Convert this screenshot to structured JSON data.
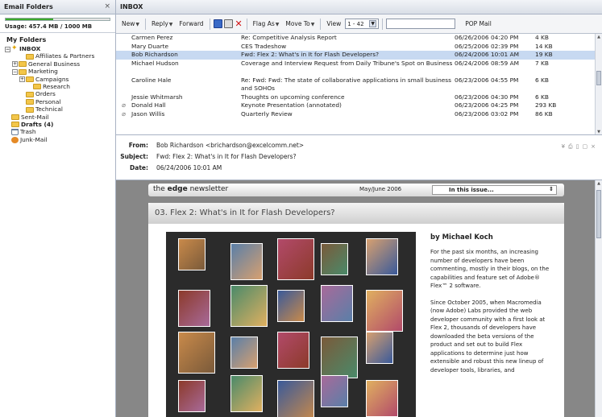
{
  "folders_panel": {
    "title": "Email Folders",
    "close": "×",
    "usage": {
      "text": "Usage: 457.4 MB / 1000 MB",
      "fraction": 0.4574
    },
    "root": "My Folders",
    "tree": [
      {
        "label": "INBOX",
        "indent": 0,
        "toggle": "−",
        "icon": "inbox-icon",
        "bold": true
      },
      {
        "label": "Affiliates & Partners",
        "indent": 2,
        "toggle": "",
        "icon": "folder-icon",
        "bold": false
      },
      {
        "label": "General Business",
        "indent": 1,
        "toggle": "+",
        "icon": "folder-icon",
        "bold": false
      },
      {
        "label": "Marketing",
        "indent": 1,
        "toggle": "−",
        "icon": "folder-icon",
        "bold": false
      },
      {
        "label": "Campaigns",
        "indent": 2,
        "toggle": "+",
        "icon": "folder-icon",
        "bold": false
      },
      {
        "label": "Research",
        "indent": 3,
        "toggle": "",
        "icon": "folder-icon",
        "bold": false
      },
      {
        "label": "Orders",
        "indent": 2,
        "toggle": "",
        "icon": "folder-icon",
        "bold": false
      },
      {
        "label": "Personal",
        "indent": 2,
        "toggle": "",
        "icon": "folder-icon",
        "bold": false
      },
      {
        "label": "Technical",
        "indent": 2,
        "toggle": "",
        "icon": "folder-icon",
        "bold": false
      },
      {
        "label": "Sent-Mail",
        "indent": 0,
        "toggle": "",
        "icon": "folder-icon",
        "bold": false
      },
      {
        "label": "Drafts (4)",
        "indent": 0,
        "toggle": "",
        "icon": "folder-icon",
        "bold": true
      },
      {
        "label": "Trash",
        "indent": 0,
        "toggle": "",
        "icon": "trash-icon",
        "bold": false
      },
      {
        "label": "Junk-Mail",
        "indent": 0,
        "toggle": "",
        "icon": "junk-icon",
        "bold": false
      }
    ]
  },
  "main": {
    "title": "INBOX",
    "toolbar": {
      "new": "New",
      "reply": "Reply",
      "forward": "Forward",
      "flag_as": "Flag As",
      "move_to": "Move To",
      "view": "View",
      "range": "1 - 42",
      "search_placeholder": "",
      "pop_mail": "POP Mail"
    },
    "messages": [
      {
        "from": "Carmen Perez",
        "subject": "Re: Competitive Analysis Report",
        "date": "06/26/2006 04:20 PM",
        "size": "4 KB",
        "attachment": false,
        "selected": false,
        "tall": false
      },
      {
        "from": "Mary Duarte",
        "subject": "CES Tradeshow",
        "date": "06/25/2006 02:39 PM",
        "size": "14 KB",
        "attachment": false,
        "selected": false,
        "tall": false
      },
      {
        "from": "Bob Richardson",
        "subject": "Fwd: Flex 2: What's in It for Flash Developers?",
        "date": "06/24/2006 10:01 AM",
        "size": "19 KB",
        "attachment": false,
        "selected": true,
        "tall": false
      },
      {
        "from": "Michael Hudson",
        "subject": "Coverage and Interview Request from Daily Tribune's Spot on Business",
        "date": "06/24/2006 08:59 AM",
        "size": "7 KB",
        "attachment": false,
        "selected": false,
        "tall": true
      },
      {
        "from": "Caroline Hale",
        "subject": "Re: Fwd: Fwd: The state of collaborative applications in small business and SOHOs",
        "date": "06/23/2006 04:55 PM",
        "size": "6 KB",
        "attachment": false,
        "selected": false,
        "tall": true
      },
      {
        "from": "Jessie Whitmarsh",
        "subject": "Thoughts on upcoming conference",
        "date": "06/23/2006 04:30 PM",
        "size": "6 KB",
        "attachment": false,
        "selected": false,
        "tall": false
      },
      {
        "from": "Donald Hall",
        "subject": "Keynote Presentation (annotated)",
        "date": "06/23/2006 04:25 PM",
        "size": "293 KB",
        "attachment": true,
        "selected": false,
        "tall": false
      },
      {
        "from": "Jason Willis",
        "subject": "Quarterly Review",
        "date": "06/23/2006 03:02 PM",
        "size": "86 KB",
        "attachment": true,
        "selected": false,
        "tall": false
      }
    ],
    "header": {
      "from_label": "From:",
      "from": "Bob Richardson <brichardson@excelcomm.net>",
      "subject_label": "Subject:",
      "subject": "Fwd: Flex 2: What's in It for Flash Developers?",
      "date_label": "Date:",
      "date": "06/24/2006 10:01 AM"
    },
    "newsletter": {
      "brand_pre": "the ",
      "brand_bold": "edge",
      "brand_post": " newsletter",
      "issue_date": "May/June 2006",
      "select_label": "In this issue...",
      "article_title": "03. Flex 2: What's in It for Flash Developers?",
      "author": "by Michael Koch",
      "paragraphs": [
        "For the past six months, an increasing number of developers have been commenting, mostly in their blogs, on the capabilities and feature set of Adobe® Flex™ 2 software.",
        "Since October 2005, when Macromedia (now Adobe) Labs provided the web developer community with a first look at Flex 2, thousands of developers have downloaded the beta versions of the product and set out to build Flex applications to determine just how extensible and robust this new lineup of developer tools, libraries, and"
      ]
    }
  },
  "colors": {
    "selected_row": "#c7d9f1",
    "usage_fill": "#3aa82b",
    "preview_bg": "#878787",
    "delete_red": "#d01010"
  }
}
